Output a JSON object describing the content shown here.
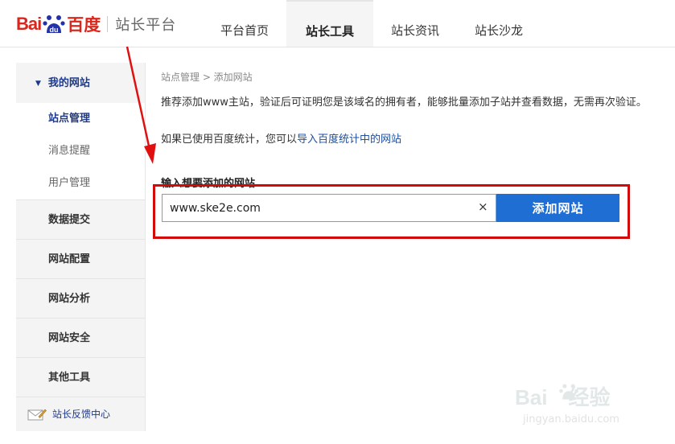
{
  "logo": {
    "brand_left": "Bai",
    "brand_mid": "du",
    "brand_right": "百度",
    "platform": "站长平台"
  },
  "nav": {
    "items": [
      {
        "label": "平台首页",
        "active": false
      },
      {
        "label": "站长工具",
        "active": true
      },
      {
        "label": "站长资讯",
        "active": false
      },
      {
        "label": "站长沙龙",
        "active": false
      }
    ]
  },
  "sidebar": {
    "my_site": "我的网站",
    "subitems": [
      {
        "label": "站点管理",
        "active": true
      },
      {
        "label": "消息提醒",
        "active": false
      },
      {
        "label": "用户管理",
        "active": false
      }
    ],
    "groups": [
      "数据提交",
      "网站配置",
      "网站分析",
      "网站安全",
      "其他工具"
    ],
    "feedback": "站长反馈中心"
  },
  "main": {
    "breadcrumb": "站点管理 > 添加网站",
    "description": "推荐添加www主站，验证后可证明您是该域名的拥有者，能够批量添加子站并查看数据，无需再次验证。",
    "hint_prefix": "如果已使用百度统计，您可以",
    "hint_link": "导入百度统计中的网站",
    "input_label": "输入想要添加的网站",
    "input_value": "www.ske2e.com",
    "clear_symbol": "×",
    "add_button": "添加网站"
  },
  "watermark": {
    "text_left": "Bai",
    "text_right": "经验",
    "url": "jingyan.baidu.com"
  },
  "colors": {
    "accent": "#1f6ed4",
    "brand_red": "#d8281e",
    "highlight_red": "#d10a0a",
    "nav_dark_blue": "#1e3a8a"
  }
}
